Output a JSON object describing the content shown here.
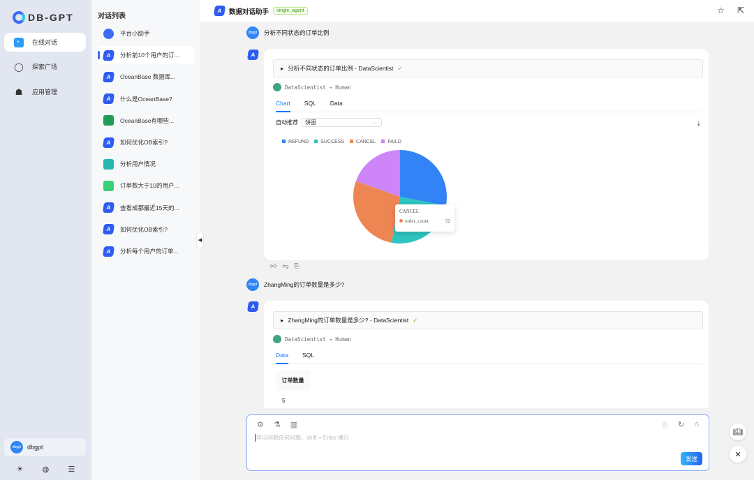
{
  "app": {
    "logo": "DB-GPT"
  },
  "nav": {
    "items": [
      {
        "label": "在线对话",
        "icon": "chat-icon"
      },
      {
        "label": "探索广场",
        "icon": "explore-icon"
      },
      {
        "label": "应用管理",
        "icon": "robot-icon"
      }
    ],
    "user": {
      "avatar": "dbgpt",
      "name": "dbgpt"
    },
    "bottom_icons": [
      "sun-icon",
      "globe-icon",
      "menu-fold-icon"
    ]
  },
  "conversations": {
    "title": "对话列表",
    "items": [
      {
        "label": "平台小助手",
        "icon": "dbgpt-icon"
      },
      {
        "label": "分析前10个用户的订...",
        "icon": "agent-icon",
        "active": true
      },
      {
        "label": "OceanBase 数据库...",
        "icon": "agent-icon"
      },
      {
        "label": "什么是OceanBase?",
        "icon": "agent-icon"
      },
      {
        "label": "OceanBase有哪些...",
        "icon": "book-icon"
      },
      {
        "label": "如何优化OB索引?",
        "icon": "agent-icon"
      },
      {
        "label": "分析用户情况",
        "icon": "dashboard-icon"
      },
      {
        "label": "订单数大于10的用户...",
        "icon": "chart-icon"
      },
      {
        "label": "查看成都最近15天的...",
        "icon": "agent-icon"
      },
      {
        "label": "如何优化OB索引?",
        "icon": "agent-icon"
      },
      {
        "label": "分析每个用户的订单...",
        "icon": "agent-icon"
      }
    ]
  },
  "header": {
    "title": "数据对话助手",
    "tag": "single_agent"
  },
  "messages": [
    {
      "user_avatar": "dbgpt",
      "question": "分析不同状态的订单比例",
      "step": "分析不同状态的订单比例 - DataScientist",
      "flow": "DataScientist → Human",
      "tabs": [
        "Chart",
        "SQL",
        "Data"
      ],
      "active_tab": "Chart",
      "chart_label": "自动推荐",
      "chart_select": "饼图",
      "tooltip": {
        "title": "CANCEL",
        "series": "order_count",
        "value": "52"
      }
    },
    {
      "user_avatar": "dbgpt",
      "question": "ZhangMing的订单数量是多少?",
      "step": "ZhangMing的订单数量是多少?  - DataScientist",
      "flow": "DataScientist → Human",
      "tabs": [
        "Data",
        "SQL"
      ],
      "active_tab": "Data",
      "table": {
        "header": "订单数量",
        "value": "5"
      }
    }
  ],
  "chart_data": {
    "type": "pie",
    "categories": [
      "REFUND",
      "SUCCESS",
      "CANCEL",
      "FAILD"
    ],
    "values": [
      53,
      47,
      52,
      37
    ],
    "series_name": "order_count",
    "colors": [
      "#3283f6",
      "#2ec4c0",
      "#ee8653",
      "#cd85f7"
    ],
    "legend": "top-left"
  },
  "input": {
    "placeholder": "可以问我任何问题，shift + Enter 换行",
    "send": "发送"
  }
}
